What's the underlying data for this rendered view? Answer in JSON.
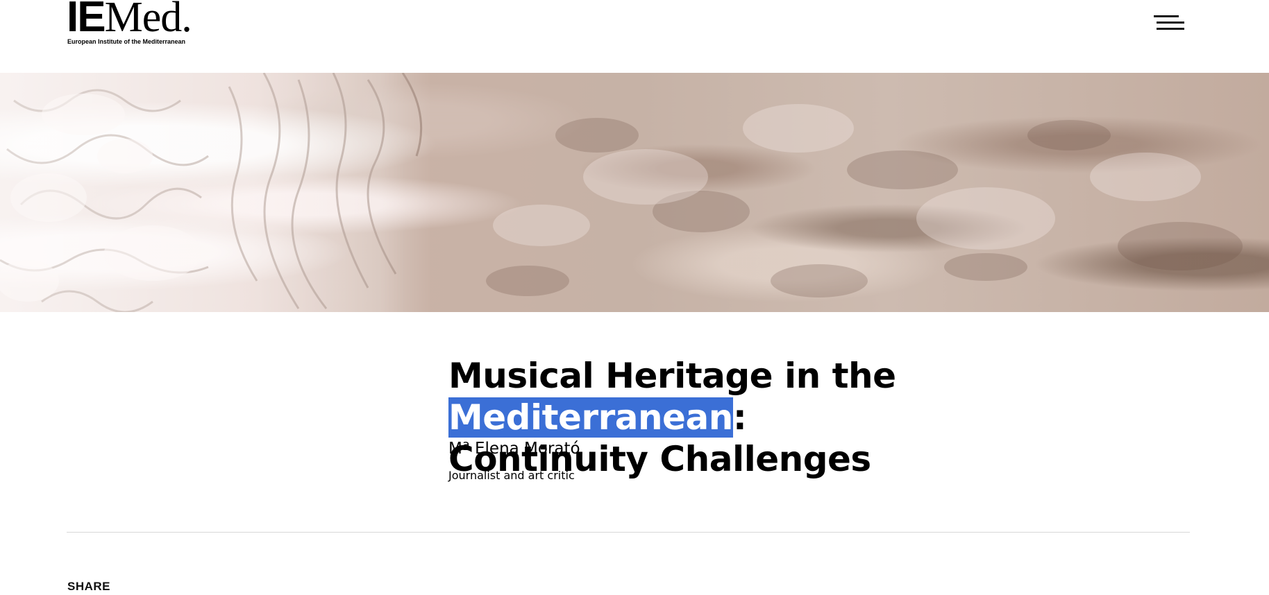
{
  "header": {
    "logo_mark_ie": "IE",
    "logo_mark_med": "Med.",
    "logo_subtitle": "European Institute of the Mediterranean",
    "menu_icon": "hamburger-menu-icon"
  },
  "hero": {
    "image_description_icon": "carved-stone-arabesque"
  },
  "article": {
    "title_part1": "Musical Heritage in the ",
    "title_highlight": "Mediterranean",
    "title_part2": ":",
    "title_line2": "Continuity Challenges",
    "author_name": "Mª Elena Morató",
    "author_role": "Journalist and art critic"
  },
  "share": {
    "label": "SHARE"
  },
  "colors": {
    "highlight": "#3b6fd6",
    "text": "#000000",
    "divider": "#d8d8d8"
  }
}
